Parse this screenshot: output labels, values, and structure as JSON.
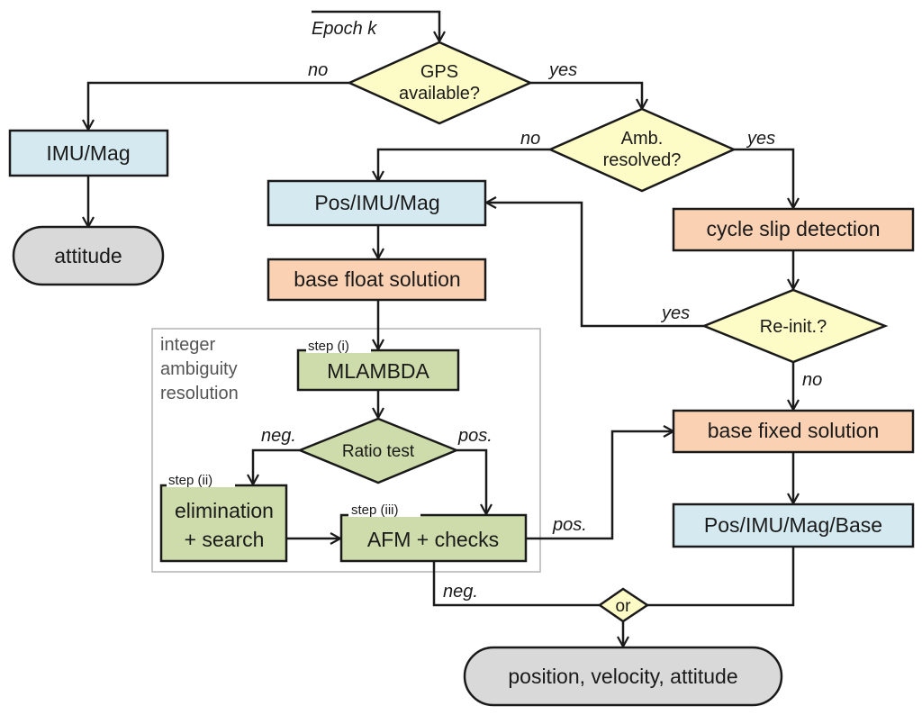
{
  "diagram": {
    "colors": {
      "sensor_box": "#d4eaf0",
      "solution_box": "#fbd1b3",
      "ambiguity_box": "#cddcaa",
      "decision": "#fdfbc6",
      "terminal": "#d9d9d9",
      "group_border": "#b3b3b3"
    },
    "start_label": "Epoch k",
    "nodes": {
      "gps_available": {
        "line1": "GPS",
        "line2": "available?"
      },
      "amb_resolved": {
        "line1": "Amb.",
        "line2": "resolved?"
      },
      "imu_mag": "IMU/Mag",
      "attitude": "attitude",
      "pos_imu_mag": "Pos/IMU/Mag",
      "base_float": "base float solution",
      "cycle_slip": "cycle slip detection",
      "reinit": "Re-init.?",
      "mlambda": "MLAMBDA",
      "ratio_test": "Ratio test",
      "elimination": {
        "line1": "elimination",
        "line2": "+ search"
      },
      "afm_checks": "AFM + checks",
      "base_fixed": "base fixed solution",
      "pos_imu_mag_base": "Pos/IMU/Mag/Base",
      "or": "or",
      "output": "position, velocity, attitude"
    },
    "group": {
      "line1": "integer",
      "line2": "ambiguity",
      "line3": "resolution"
    },
    "steps": {
      "step1": "step (i)",
      "step2": "step (ii)",
      "step3": "step (iii)"
    },
    "edge_labels": {
      "gps_no": "no",
      "gps_yes": "yes",
      "amb_no": "no",
      "amb_yes": "yes",
      "reinit_yes": "yes",
      "reinit_no": "no",
      "ratio_neg": "neg.",
      "ratio_pos": "pos.",
      "afm_pos": "pos.",
      "afm_neg": "neg."
    }
  }
}
